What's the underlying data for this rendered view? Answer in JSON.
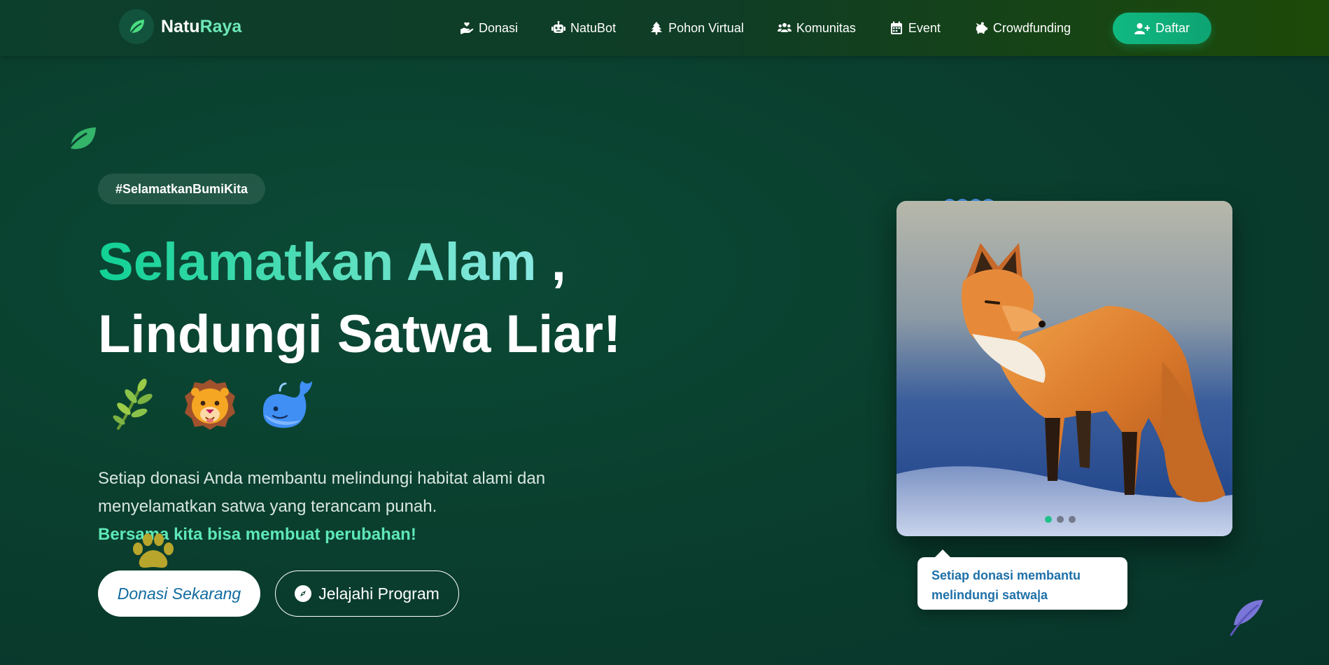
{
  "nav": {
    "brand_part1": "Natu",
    "brand_part2": "Raya",
    "items": [
      {
        "label": "Donasi",
        "icon": "hand-heart-icon"
      },
      {
        "label": "NatuBot",
        "icon": "robot-icon"
      },
      {
        "label": "Pohon Virtual",
        "icon": "tree-icon"
      },
      {
        "label": "Komunitas",
        "icon": "users-icon"
      },
      {
        "label": "Event",
        "icon": "calendar-icon"
      },
      {
        "label": "Crowdfunding",
        "icon": "piggy-bank-icon"
      }
    ],
    "register_label": "Daftar"
  },
  "hero": {
    "hashtag": "#SelamatkanBumiKita",
    "title_line1": "Selamatkan Alam",
    "title_comma": " ,",
    "title_line2": "Lindungi Satwa Liar!",
    "emojis": [
      "🌿",
      "🦁",
      "🐳"
    ],
    "description": "Setiap donasi Anda membantu melindungi habitat alami dan menyelamatkan satwa yang terancam punah.",
    "emphasis": "Bersama kita bisa membuat perubahan!",
    "primary_cta": "Donasi Sekarang",
    "secondary_cta": "Jelajahi Program"
  },
  "slider": {
    "image_subject": "red fox in snow",
    "slide_count": 3,
    "active_slide": 1,
    "tooltip_text": "Setiap donasi membantu melindungi satwa|a"
  },
  "colors": {
    "accent": "#10b981",
    "accent_light": "#5ee8b8",
    "background": "#0a3f2e",
    "navbar": "#0d3f2d"
  }
}
